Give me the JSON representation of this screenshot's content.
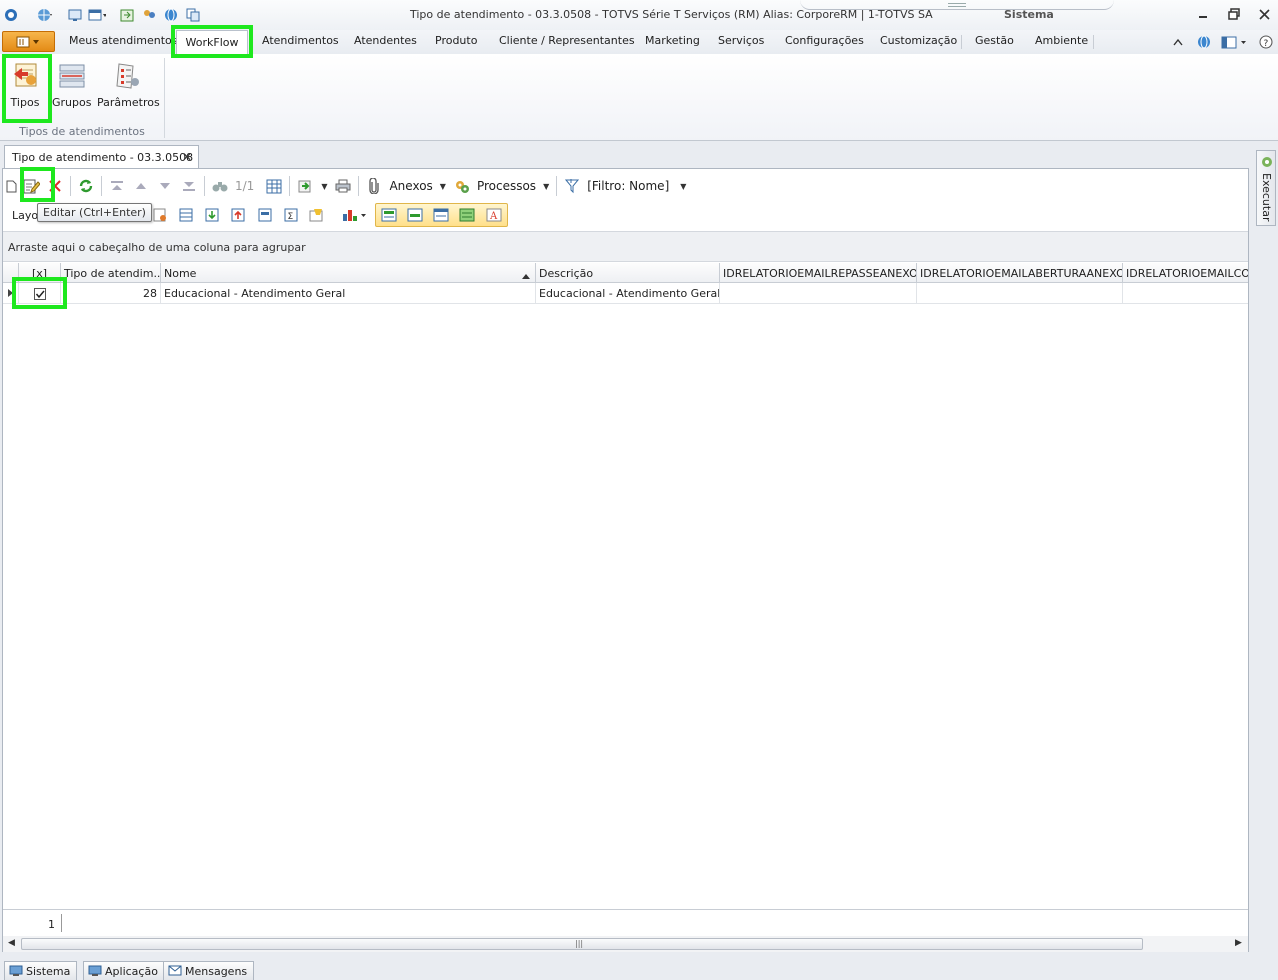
{
  "window": {
    "title": "Tipo de atendimento - 03.3.0508 - TOTVS Série T Serviços (RM) Alias: CorporeRM | 1-TOTVS SA",
    "right_title": "Sistema"
  },
  "ribbon_tabs": [
    {
      "label": "Meus atendimentos"
    },
    {
      "label": "WorkFlow",
      "active": true
    },
    {
      "label": "Atendimentos"
    },
    {
      "label": "Atendentes"
    },
    {
      "label": "Produto"
    },
    {
      "label": "Cliente / Representantes"
    },
    {
      "label": "Marketing"
    },
    {
      "label": "Serviços"
    },
    {
      "label": "Configurações"
    },
    {
      "label": "Customização"
    },
    {
      "label": "Gestão"
    },
    {
      "label": "Ambiente"
    }
  ],
  "ribbon_buttons": [
    {
      "label": "Tipos",
      "icon": "tipos-icon"
    },
    {
      "label": "Grupos",
      "icon": "grupos-icon"
    },
    {
      "label": "Parâmetros",
      "icon": "parametros-icon"
    }
  ],
  "ribbon_group_label": "Tipos de atendimentos",
  "document_tab": {
    "label": "Tipo de atendimento - 03.3.0508",
    "close": "✕"
  },
  "dock": {
    "label": "Executar"
  },
  "toolbar": {
    "page_indicator": "1/1",
    "anexos": "Anexos",
    "processos": "Processos",
    "filter": "[Filtro: Nome]",
    "layout_label": "Layo",
    "tooltip": "Editar (Ctrl+Enter)"
  },
  "group_hint": "Arraste aqui o cabeçalho de uma coluna para agrupar",
  "grid": {
    "columns": [
      "[x]",
      "Tipo de atendim...",
      "Nome",
      "Descrição",
      "IDRELATORIOEMAILREPASSEANEXO",
      "IDRELATORIOEMAILABERTURAANEXO",
      "IDRELATORIOEMAILCON"
    ],
    "rows": [
      {
        "checked": true,
        "tipo": "28",
        "nome": "Educacional - Atendimento Geral",
        "descricao": "Educacional - Atendimento Geral",
        "c4": "",
        "c5": "",
        "c6": ""
      }
    ],
    "record_count": "1"
  },
  "taskbar": [
    {
      "label": "Sistema"
    },
    {
      "label": "Aplicação"
    },
    {
      "label": "Mensagens"
    }
  ],
  "colors": {
    "highlight": "#1ee81e",
    "accent_orange": "#e38b16"
  }
}
